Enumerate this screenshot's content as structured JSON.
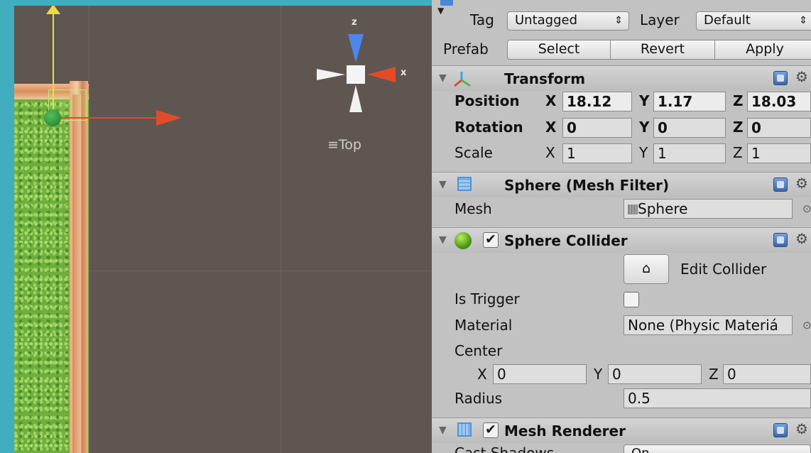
{
  "scene": {
    "view_label": "Top",
    "gizmo_z": "z",
    "gizmo_x": "x",
    "menu_icon": "hamburger-icon"
  },
  "inspector": {
    "tag_label": "Tag",
    "tag_value": "Untagged",
    "layer_label": "Layer",
    "layer_value": "Default",
    "prefab_label": "Prefab",
    "prefab_buttons": [
      "Select",
      "Revert",
      "Apply"
    ],
    "transform": {
      "title": "Transform",
      "position_label": "Position",
      "rotation_label": "Rotation",
      "scale_label": "Scale",
      "position": {
        "x": "18.12",
        "y": "1.17",
        "z": "18.03"
      },
      "rotation": {
        "x": "0",
        "y": "0",
        "z": "0"
      },
      "scale": {
        "x": "1",
        "y": "1",
        "z": "1"
      },
      "axis_x": "X",
      "axis_y": "Y",
      "axis_z": "Z"
    },
    "mesh_filter": {
      "title": "Sphere (Mesh Filter)",
      "mesh_label": "Mesh",
      "mesh_value": "Sphere"
    },
    "sphere_collider": {
      "title": "Sphere Collider",
      "enabled": true,
      "edit_label": "Edit Collider",
      "is_trigger_label": "Is Trigger",
      "material_label": "Material",
      "material_value": "None (Physic Materiá",
      "center_label": "Center",
      "center": {
        "x": "0",
        "y": "0",
        "z": "0"
      },
      "radius_label": "Radius",
      "radius_value": "0.5"
    },
    "mesh_renderer": {
      "title": "Mesh Renderer",
      "enabled": true,
      "cast_shadows_label": "Cast Shadows",
      "cast_shadows_value": "On"
    }
  }
}
